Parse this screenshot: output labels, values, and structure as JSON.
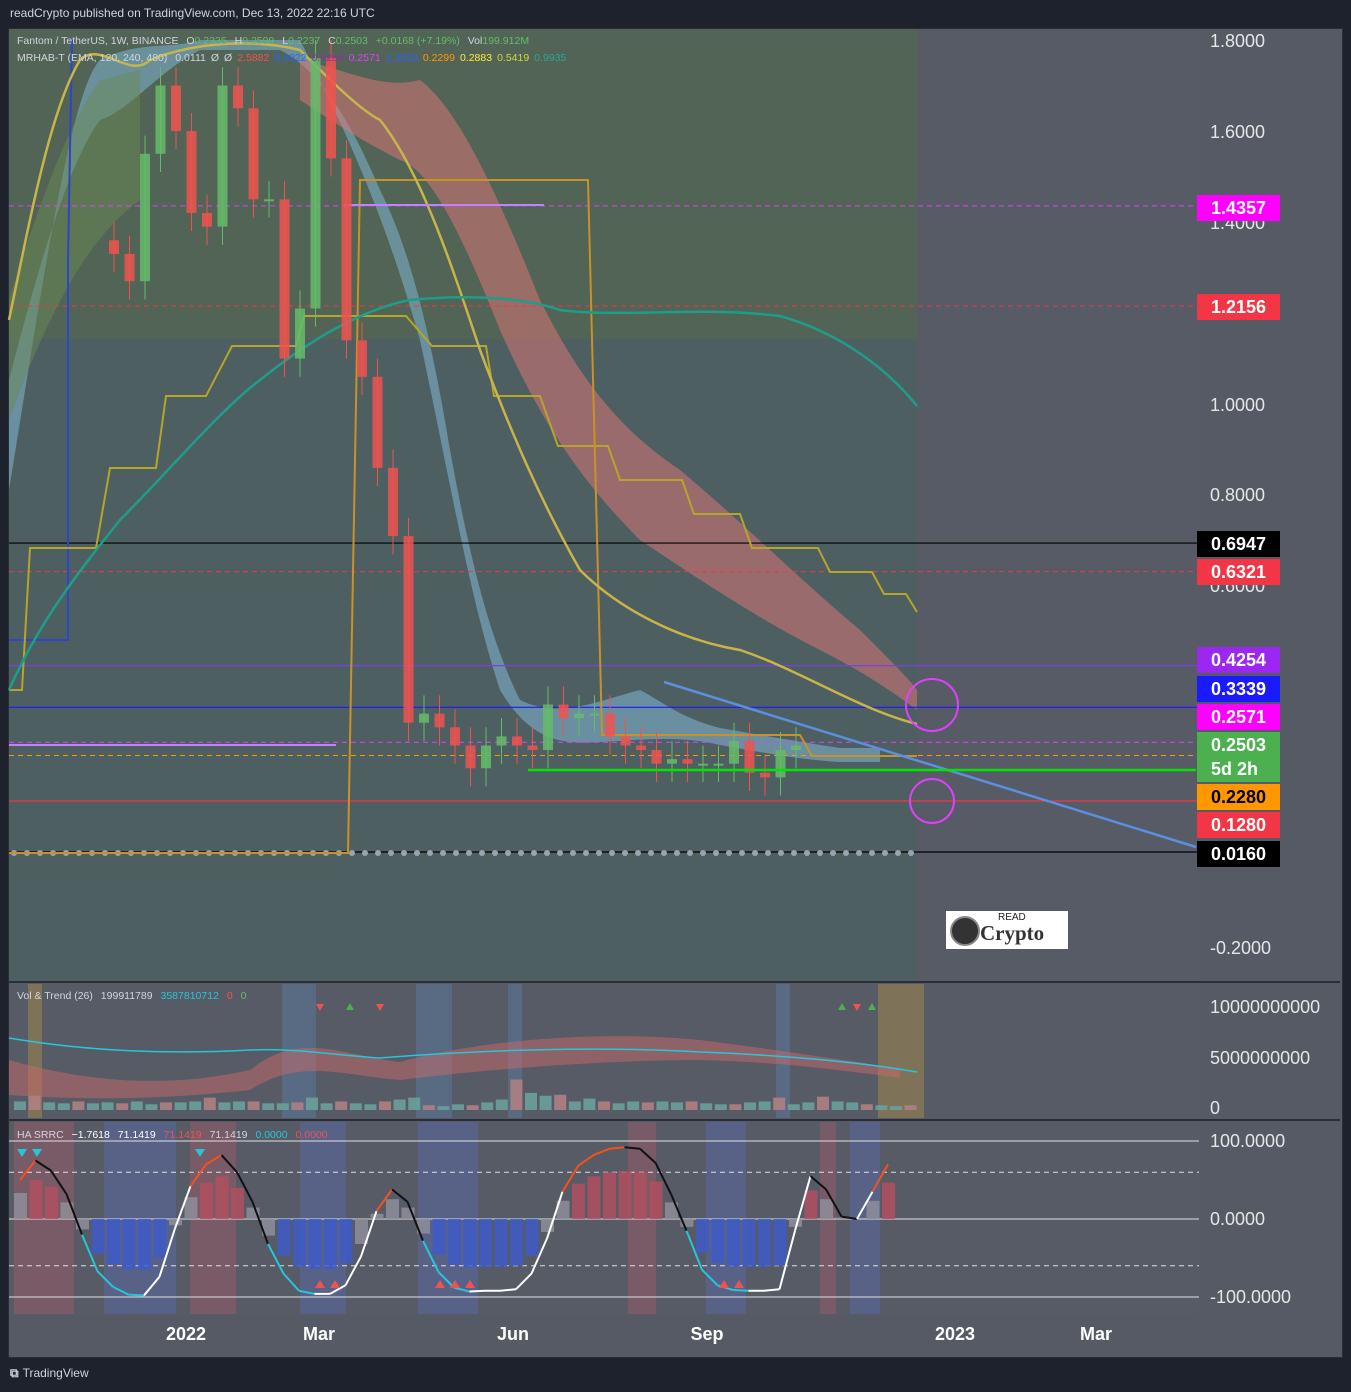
{
  "header": {
    "published": "readCrypto published on TradingView.com, Dec 13, 2022 22:16 UTC"
  },
  "legend": {
    "symbol": "Fantom / TetherUS, 1W, BINANCE",
    "o_label": "O",
    "o": "0.2335",
    "h_label": "H",
    "h": "0.2599",
    "l_label": "L",
    "l": "0.2237",
    "c_label": "C",
    "c": "0.2503",
    "change": "+0.0168 (+7.19%)",
    "vol_label": "Vol",
    "vol": "199.912M",
    "mrhab": "MRHAB-T (EMA, 120, 240, 480)",
    "mrhab_vals": [
      "0.0111",
      "Ø",
      "Ø",
      "2.5882",
      "0.0022",
      "0.4254",
      "0.2571",
      "2.3018",
      "0.2299",
      "0.2883",
      "0.5419",
      "0.9935"
    ],
    "mrhab_colors": [
      "#d1d4dc",
      "#d1d4dc",
      "#d1d4dc",
      "#ef5350",
      "#2962ff",
      "#9c27b0",
      "#e040fb",
      "#2962ff",
      "#ff9800",
      "#ffeb3b",
      "#cddc39",
      "#26a69a"
    ]
  },
  "vol_legend": {
    "name": "Vol & Trend (26)",
    "v1": "199911789",
    "v2": "3587810712",
    "v3": "0",
    "v4": "0"
  },
  "ha_legend": {
    "name": "HA SRRC",
    "v1": "−1.7618",
    "v2": "71.1419",
    "v3": "71.1419",
    "v4": "71.1419",
    "v5": "0.0000",
    "v6": "0.0000"
  },
  "footer": {
    "brand": "TradingView"
  },
  "watermark": {
    "top": "READ",
    "bottom": "Crypto"
  },
  "colors": {
    "up": "#66bb6a",
    "down": "#ef5350",
    "fast_band": "#7fb6d3",
    "slow_band": "#d77474",
    "ema_teal": "#1e9d8b",
    "step_yellow": "#b5a528",
    "step_orange": "#c89225",
    "step_blue": "#2d45c8",
    "trend_line": "#5b8fe0",
    "support_green": "#00e600",
    "magenta": "#e040fb"
  },
  "chart_data": [
    {
      "type": "candlestick",
      "title": "Fantom / TetherUS, 1W, BINANCE",
      "xlabel": "",
      "ylabel": "",
      "ylim": [
        -0.28,
        1.82
      ],
      "x_ticks": [
        "2022",
        "Mar",
        "Jun",
        "Sep",
        "2023",
        "Mar"
      ],
      "y_ticks": [
        "1.8000",
        "1.6000",
        "1.4000",
        "1.0000",
        "0.8000",
        "0.6000",
        "-0.2000"
      ],
      "price_tags": [
        {
          "value": "1.4357",
          "color": "#ff00ff",
          "text_color": "#ffffff"
        },
        {
          "value": "1.2156",
          "color": "#f23645",
          "text_color": "#ffffff"
        },
        {
          "value": "0.6947",
          "color": "#000000",
          "text_color": "#ffffff"
        },
        {
          "value": "0.6321",
          "color": "#f23645",
          "text_color": "#ffffff"
        },
        {
          "value": "0.4254",
          "color": "#9c27f0",
          "text_color": "#ffffff"
        },
        {
          "value": "0.3339",
          "color": "#1a1aff",
          "text_color": "#ffffff"
        },
        {
          "value": "0.2571",
          "color": "#ff00ff",
          "text_color": "#ffffff"
        },
        {
          "value": "0.2503",
          "color": "#4caf50",
          "text_color": "#ffffff",
          "sub": "5d 2h"
        },
        {
          "value": "0.2280",
          "color": "#ff9800",
          "text_color": "#000000"
        },
        {
          "value": "0.1280",
          "color": "#f23645",
          "text_color": "#ffffff"
        },
        {
          "value": "0.0160",
          "color": "#000000",
          "text_color": "#ffffff"
        }
      ],
      "horizontal_levels": [
        {
          "y": 1.4357,
          "style": "dashed",
          "color": "#e040fb"
        },
        {
          "y": 1.2156,
          "style": "dashed",
          "color": "#f23645"
        },
        {
          "y": 0.6947,
          "style": "solid",
          "color": "#000000"
        },
        {
          "y": 0.6321,
          "style": "dashed",
          "color": "#f23645"
        },
        {
          "y": 0.4254,
          "style": "solid",
          "color": "#7b3fe4"
        },
        {
          "y": 0.3339,
          "style": "solid",
          "color": "#1a1aff"
        },
        {
          "y": 0.2571,
          "style": "dashed",
          "color": "#e040fb"
        },
        {
          "y": 0.228,
          "style": "dashed",
          "color": "#ff9800"
        },
        {
          "y": 0.128,
          "style": "solid",
          "color": "#f23645"
        },
        {
          "y": 0.016,
          "style": "solid",
          "color": "#000000"
        }
      ],
      "series": [
        {
          "name": "close",
          "values": [
            1.33,
            1.27,
            1.55,
            1.7,
            1.6,
            1.42,
            1.39,
            1.7,
            1.65,
            1.45,
            1.45,
            1.1,
            1.21,
            1.76,
            1.54,
            1.14,
            1.06,
            0.86,
            0.71,
            0.3,
            0.32,
            0.29,
            0.25,
            0.2,
            0.25,
            0.27,
            0.25,
            0.24,
            0.34,
            0.31,
            0.32,
            0.32,
            0.27,
            0.25,
            0.24,
            0.21,
            0.22,
            0.21,
            0.21,
            0.21,
            0.26,
            0.19,
            0.18,
            0.24,
            0.25
          ]
        }
      ]
    },
    {
      "type": "bar",
      "title": "Vol & Trend (26)",
      "ylim": [
        0,
        10500000000
      ],
      "y_ticks": [
        "10000000000",
        "5000000000",
        "0"
      ],
      "values": [
        0.9,
        1.5,
        0.8,
        0.7,
        0.9,
        0.7,
        0.8,
        0.7,
        0.9,
        0.6,
        0.8,
        0.8,
        0.9,
        1.3,
        0.8,
        0.9,
        0.9,
        0.7,
        0.7,
        0.8,
        1.3,
        0.7,
        0.9,
        0.7,
        0.6,
        0.9,
        1.1,
        1.3,
        0.5,
        0.4,
        0.6,
        0.5,
        0.8,
        1.1,
        3.2,
        1.8,
        1.5,
        1.6,
        0.9,
        1.2,
        0.9,
        0.7,
        0.9,
        0.8,
        0.9,
        0.8,
        0.9,
        0.7,
        0.6,
        0.6,
        0.8,
        0.9,
        1.3,
        0.6,
        0.8,
        1.4,
        0.9,
        0.8,
        0.6,
        0.5,
        0.4,
        0.5
      ],
      "markers": [
        "down",
        "up",
        "down",
        "up",
        "down",
        "up"
      ]
    },
    {
      "type": "line",
      "title": "HA SRRC",
      "ylim": [
        -100,
        100
      ],
      "y_ticks": [
        "100.0000",
        "0.0000",
        "-100.0000"
      ],
      "series": [
        {
          "name": "",
          "values": [
            50,
            75,
            62,
            32,
            -20,
            -67,
            -87,
            -97,
            -98,
            -74,
            -12,
            42,
            70,
            82,
            60,
            22,
            -32,
            -70,
            -92,
            -96,
            -96,
            -85,
            -48,
            10,
            38,
            22,
            -28,
            -68,
            -88,
            -93,
            -92,
            -92,
            -90,
            -70,
            -25,
            35,
            68,
            82,
            90,
            92,
            90,
            72,
            32,
            -15,
            -65,
            -85,
            -91,
            -92,
            -92,
            -90,
            -15,
            55,
            38,
            3,
            0,
            35,
            70
          ]
        }
      ]
    }
  ]
}
